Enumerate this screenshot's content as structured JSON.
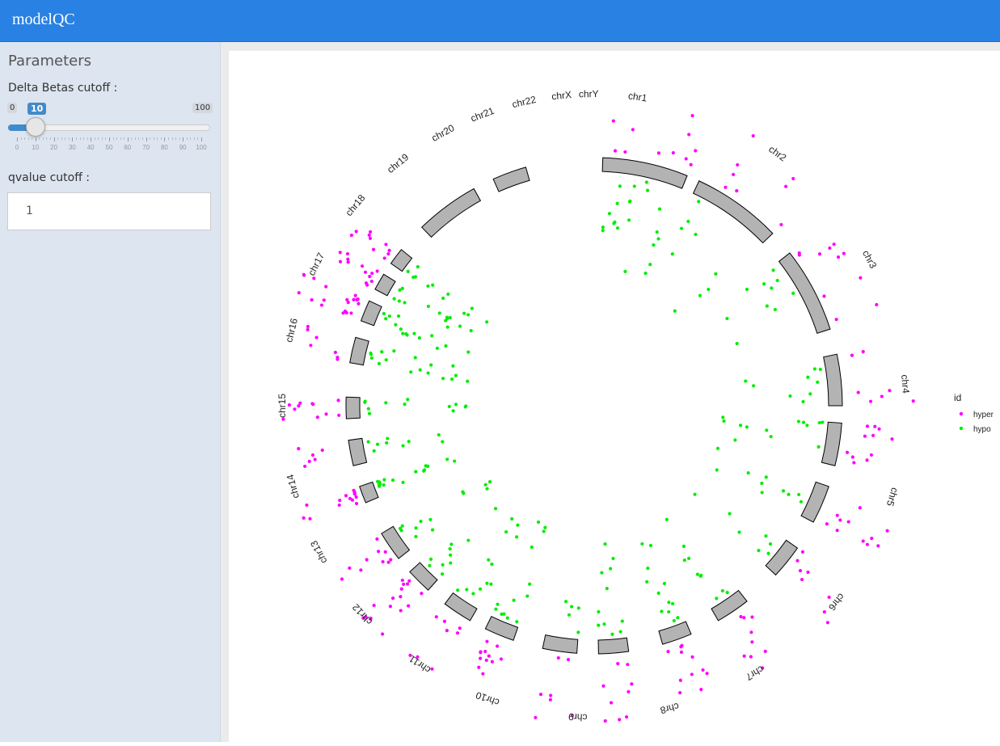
{
  "app": {
    "title": "modelQC"
  },
  "sidebar": {
    "heading": "Parameters",
    "delta_label": "Delta Betas cutoff :",
    "slider": {
      "min": "0",
      "max": "100",
      "value": "10",
      "fraction": 0.1,
      "ticks": [
        "0",
        "10",
        "20",
        "30",
        "40",
        "50",
        "60",
        "70",
        "80",
        "90",
        "100"
      ]
    },
    "qvalue_label": "qvalue cutoff :",
    "qvalue_value": "1"
  },
  "chart_data": {
    "type": "scatter",
    "title": "",
    "chromosomes": [
      "chr1",
      "chr2",
      "chr3",
      "chr4",
      "chr5",
      "chr6",
      "chr7",
      "chr8",
      "chr9",
      "chr10",
      "chr11",
      "chr12",
      "chr13",
      "chr14",
      "chr15",
      "chr16",
      "chr17",
      "chr18",
      "chr19",
      "chr20",
      "chr21",
      "chr22",
      "chrX",
      "chrY"
    ],
    "legend": {
      "title": "id",
      "entries": [
        "hyper",
        "hypo"
      ]
    },
    "colors": {
      "hyper": "#ff00ff",
      "hypo": "#00ee00",
      "ideogram": "#b3b3b3"
    }
  }
}
